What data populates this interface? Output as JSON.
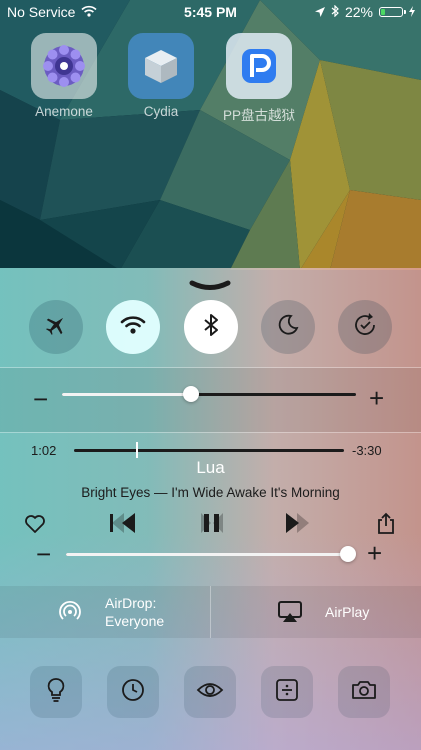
{
  "status_bar": {
    "carrier": "No Service",
    "time": "5:45 PM",
    "battery_percent": "22%",
    "battery_level": 0.22
  },
  "apps": [
    {
      "label": "Anemone",
      "icon": "anemone-icon"
    },
    {
      "label": "Cydia",
      "icon": "cydia-icon"
    },
    {
      "label": "PP盘古越狱",
      "icon": "pp-icon"
    }
  ],
  "control_center": {
    "toggles": [
      {
        "name": "airplane-mode",
        "icon": "airplane-icon",
        "on": false
      },
      {
        "name": "wifi",
        "icon": "wifi-icon",
        "on": true
      },
      {
        "name": "bluetooth",
        "icon": "bluetooth-icon",
        "on": true
      },
      {
        "name": "do-not-disturb",
        "icon": "moon-icon",
        "on": false
      },
      {
        "name": "rotation-lock",
        "icon": "rotation-lock-icon",
        "on": false
      }
    ],
    "brightness": {
      "minus": "−",
      "plus": "+",
      "level": 0.44
    },
    "music": {
      "elapsed": "1:02",
      "remaining": "-3:30",
      "progress": 0.23,
      "title": "Lua",
      "subtitle": "Bright Eyes — I'm Wide Awake It's Morning",
      "volume": {
        "minus": "−",
        "plus": "+",
        "level": 1.0
      }
    },
    "airdrop": {
      "line1": "AirDrop:",
      "line2": "Everyone"
    },
    "airplay": {
      "label": "AirPlay"
    },
    "utilities": [
      {
        "name": "flashlight",
        "icon": "flashlight-icon"
      },
      {
        "name": "clock",
        "icon": "clock-icon"
      },
      {
        "name": "night-shift",
        "icon": "eye-icon"
      },
      {
        "name": "calculator",
        "icon": "calculator-icon"
      },
      {
        "name": "camera",
        "icon": "camera-icon"
      }
    ]
  }
}
